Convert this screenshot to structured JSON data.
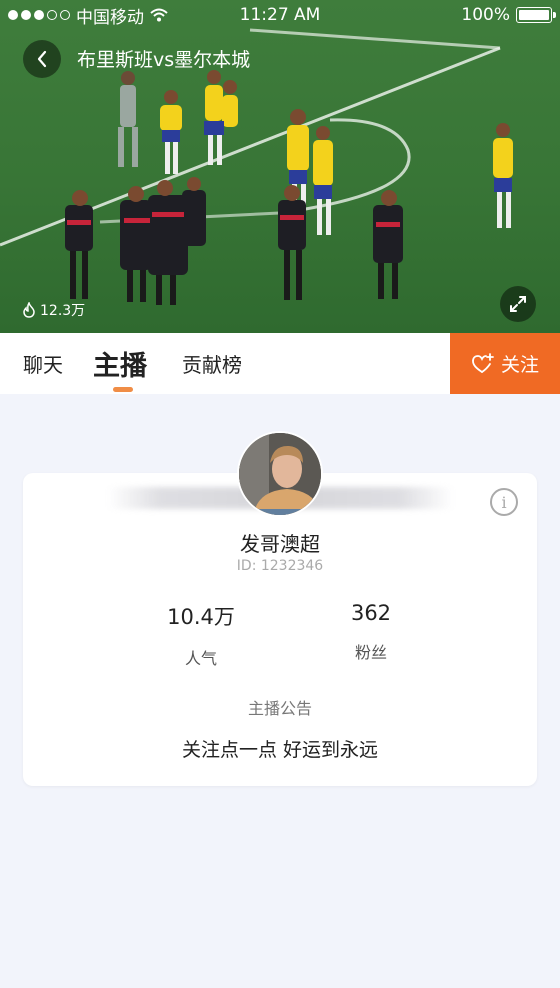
{
  "status_bar": {
    "carrier": "中国移动",
    "time": "11:27 AM",
    "battery": "100%"
  },
  "video": {
    "title": "布里斯班vs墨尔本城",
    "viewer_count": "12.3万"
  },
  "tabs": [
    {
      "label": "聊天"
    },
    {
      "label": "主播"
    },
    {
      "label": "贡献榜"
    }
  ],
  "follow_button": {
    "label": "关注"
  },
  "streamer": {
    "name": "发哥澳超",
    "id_text": "ID: 1232346",
    "stats": [
      {
        "value": "10.4万",
        "label": "人气"
      },
      {
        "value": "362",
        "label": "粉丝"
      }
    ],
    "notice_label": "主播公告",
    "notice_text": "关注点一点 好运到永远"
  },
  "colors": {
    "accent": "#f06a24",
    "tab_indicator": "#f08d46",
    "page_bg": "#f2f4fb"
  }
}
